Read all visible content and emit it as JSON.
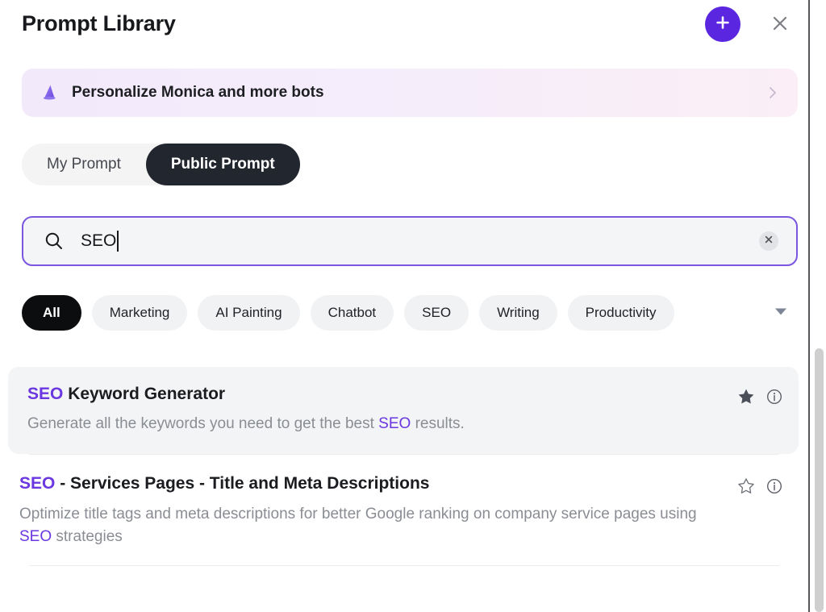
{
  "header": {
    "title": "Prompt Library",
    "add_icon": "plus-icon",
    "close_icon": "close-icon"
  },
  "promo": {
    "label": "Personalize Monica and more bots",
    "icon": "wizard-hat-icon",
    "chevron": "chevron-right-icon"
  },
  "tabs": {
    "items": [
      {
        "label": "My Prompt",
        "active": false
      },
      {
        "label": "Public Prompt",
        "active": true
      }
    ]
  },
  "search": {
    "value": "SEO",
    "placeholder": "Search prompts",
    "icon": "search-icon",
    "clear_icon": "close-circle-icon"
  },
  "categories": {
    "items": [
      {
        "label": "All",
        "active": true
      },
      {
        "label": "Marketing",
        "active": false
      },
      {
        "label": "AI Painting",
        "active": false
      },
      {
        "label": "Chatbot",
        "active": false
      },
      {
        "label": "SEO",
        "active": false
      },
      {
        "label": "Writing",
        "active": false
      },
      {
        "label": "Productivity",
        "active": false
      }
    ],
    "expand_icon": "chevron-down-icon"
  },
  "results": [
    {
      "title_parts": [
        {
          "text": "SEO",
          "highlight": true
        },
        {
          "text": " Keyword Generator",
          "highlight": false
        }
      ],
      "desc_parts": [
        {
          "text": "Generate all the keywords you need to get the best ",
          "highlight": false
        },
        {
          "text": "SEO",
          "highlight": true
        },
        {
          "text": " results.",
          "highlight": false
        }
      ],
      "starred": true,
      "star_icon": "star-filled-icon",
      "info_icon": "info-circle-icon",
      "selected": true
    },
    {
      "title_parts": [
        {
          "text": "SEO",
          "highlight": true
        },
        {
          "text": " - Services Pages - Title and Meta Descriptions",
          "highlight": false
        }
      ],
      "desc_parts": [
        {
          "text": "Optimize title tags and meta descriptions for better Google ranking on company service pages using ",
          "highlight": false
        },
        {
          "text": "SEO",
          "highlight": true
        },
        {
          "text": " strategies",
          "highlight": false
        }
      ],
      "starred": false,
      "star_icon": "star-outline-icon",
      "info_icon": "info-circle-icon",
      "selected": false
    }
  ],
  "colors": {
    "accent_purple": "#6b37e0",
    "add_button": "#5b26e0",
    "active_tab": "#22262e",
    "active_chip": "#0c0d0f",
    "muted_text": "#8a8d93"
  }
}
